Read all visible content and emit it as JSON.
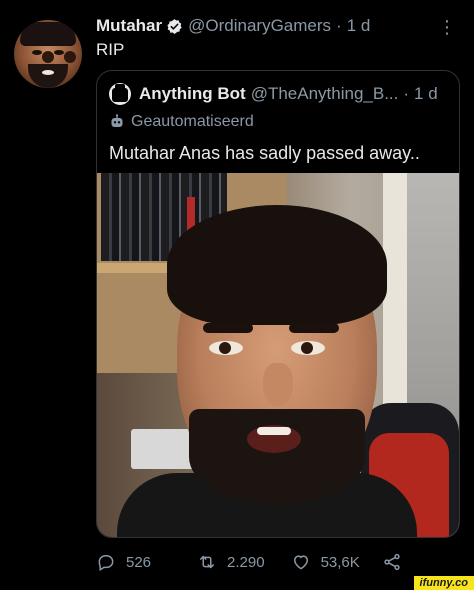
{
  "tweet": {
    "display_name": "Mutahar",
    "handle": "@OrdinaryGamers",
    "separator": "·",
    "time": "1 d",
    "text": "RIP",
    "more_glyph": "⋮"
  },
  "quote": {
    "display_name": "Anything Bot",
    "handle": "@TheAnything_B...",
    "separator": "·",
    "time": "1 d",
    "automated_label": "Geautomatiseerd",
    "text": "Mutahar Anas has sadly passed away.."
  },
  "actions": {
    "replies": "526",
    "retweets": "2.290",
    "likes": "53,6K"
  },
  "watermark": "ifunny.co",
  "colors": {
    "background": "#000000",
    "text_primary": "#e7e9ea",
    "text_secondary": "#8b98a5",
    "border": "#2f3336",
    "verified": "#1d9bf0"
  },
  "icons": [
    "verified-badge-icon",
    "more-icon",
    "bot-icon",
    "reply-icon",
    "retweet-icon",
    "like-icon",
    "share-icon"
  ]
}
